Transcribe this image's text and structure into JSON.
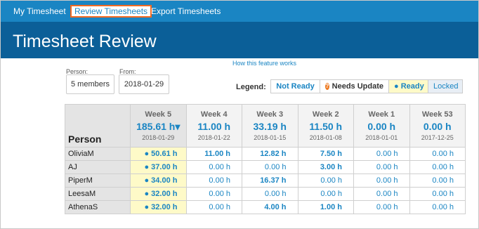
{
  "nav": {
    "items": [
      {
        "label": "My Timesheet"
      },
      {
        "label": "Review Timesheets"
      },
      {
        "label": "Export Timesheets"
      }
    ]
  },
  "page": {
    "title": "Timesheet Review",
    "help_link": "How this feature works"
  },
  "filters": {
    "person": {
      "label": "Person:",
      "value": "5 members"
    },
    "from": {
      "label": "From:",
      "value": "2018-01-29"
    }
  },
  "legend": {
    "label": "Legend:",
    "items": [
      "Not Ready",
      "Needs Update",
      "Ready",
      "Locked"
    ],
    "needs_update_icon": "question-icon"
  },
  "table": {
    "person_header": "Person",
    "weeks": [
      {
        "name": "Week 5",
        "hours": "185.61 h▾",
        "date": "2018-01-29"
      },
      {
        "name": "Week 4",
        "hours": "11.00 h",
        "date": "2018-01-22"
      },
      {
        "name": "Week 3",
        "hours": "33.19 h",
        "date": "2018-01-15"
      },
      {
        "name": "Week 2",
        "hours": "11.50 h",
        "date": "2018-01-08"
      },
      {
        "name": "Week 1",
        "hours": "0.00 h",
        "date": "2018-01-01"
      },
      {
        "name": "Week 53",
        "hours": "0.00 h",
        "date": "2017-12-25"
      }
    ],
    "rows": [
      {
        "person": "OliviaM",
        "cells": [
          "● 50.61 h",
          "11.00 h",
          "12.82 h",
          "7.50 h",
          "0.00 h",
          "0.00 h"
        ]
      },
      {
        "person": "AJ",
        "cells": [
          "● 37.00 h",
          "0.00 h",
          "0.00 h",
          "3.00 h",
          "0.00 h",
          "0.00 h"
        ]
      },
      {
        "person": "PiperM",
        "cells": [
          "● 34.00 h",
          "0.00 h",
          "16.37 h",
          "0.00 h",
          "0.00 h",
          "0.00 h"
        ]
      },
      {
        "person": "LeesaM",
        "cells": [
          "● 32.00 h",
          "0.00 h",
          "0.00 h",
          "0.00 h",
          "0.00 h",
          "0.00 h"
        ]
      },
      {
        "person": "AthenaS",
        "cells": [
          "● 32.00 h",
          "0.00 h",
          "4.00 h",
          "1.00 h",
          "0.00 h",
          "0.00 h"
        ]
      }
    ]
  },
  "colors": {
    "nav_bg": "#1a85c3",
    "banner_bg": "#0b5f98",
    "active_border": "#f26a22",
    "link": "#1a85c3",
    "ready_bg": "#fefac8",
    "needs_update": "#ee7a22"
  }
}
